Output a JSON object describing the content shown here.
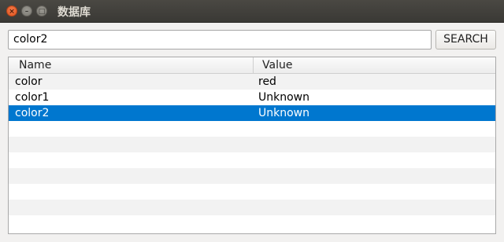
{
  "window": {
    "title": "数据库",
    "close_glyph": "×",
    "minimize_glyph": "–",
    "maximize_glyph": "□"
  },
  "search": {
    "value": "color2",
    "button_label": "SEARCH"
  },
  "table": {
    "columns": [
      "Name",
      "Value"
    ],
    "rows": [
      {
        "name": "color",
        "value": "red"
      },
      {
        "name": "color1",
        "value": "Unknown"
      },
      {
        "name": "color2",
        "value": "Unknown"
      }
    ],
    "selected_index": 2
  },
  "colors": {
    "selection": "#0077cf",
    "titlebar": "#3c3b37",
    "close_button": "#e9591f"
  }
}
